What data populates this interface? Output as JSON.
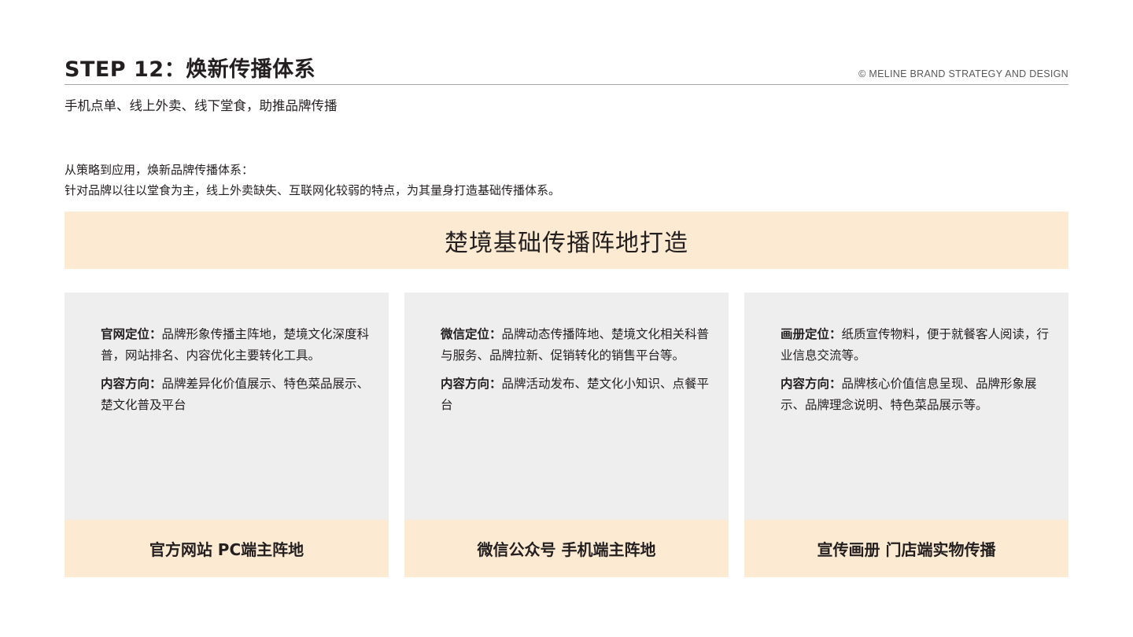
{
  "header": {
    "title": "STEP 12：焕新传播体系",
    "copyright": "© MELINE BRAND STRATEGY AND DESIGN",
    "subtitle": "手机点单、线上外卖、线下堂食，助推品牌传播"
  },
  "intro": {
    "line1": "从策略到应用，焕新品牌传播体系：",
    "line2": "针对品牌以往以堂食为主，线上外卖缺失、互联网化较弱的特点，为其量身打造基础传播体系。"
  },
  "banner": {
    "text": "楚境基础传播阵地打造"
  },
  "cards": [
    {
      "label1": "官网定位：",
      "text1": "品牌形象传播主阵地，楚境文化深度科普，网站排名、内容优化主要转化工具。",
      "label2": "内容方向：",
      "text2": "品牌差异化价值展示、特色菜品展示、楚文化普及平台",
      "footer": "官方网站 PC端主阵地"
    },
    {
      "label1": "微信定位：",
      "text1": "品牌动态传播阵地、楚境文化相关科普与服务、品牌拉新、促销转化的销售平台等。",
      "label2": "内容方向：",
      "text2": "品牌活动发布、楚文化小知识、点餐平台",
      "footer": "微信公众号 手机端主阵地"
    },
    {
      "label1": "画册定位：",
      "text1": "纸质宣传物料，便于就餐客人阅读，行业信息交流等。",
      "label2": "内容方向：",
      "text2": "品牌核心价值信息呈现、品牌形象展示、品牌理念说明、特色菜品展示等。",
      "footer": "宣传画册 门店端实物传播"
    }
  ],
  "colors": {
    "accent_bg": "#fcebd2",
    "card_bg": "#eeeeee",
    "text": "#231f20",
    "rule": "#a7a7a7"
  }
}
